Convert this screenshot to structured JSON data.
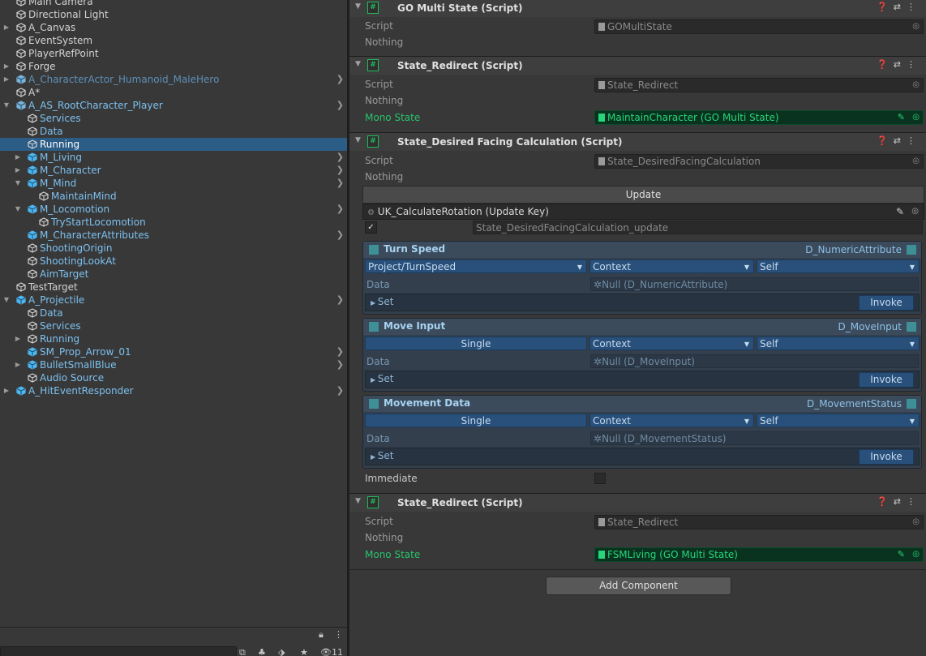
{
  "hierarchy": {
    "items": [
      {
        "label": "Main Camera",
        "indent": 0,
        "fold": "",
        "icon": "cube-icon",
        "chevron": false
      },
      {
        "label": "Directional Light",
        "indent": 0,
        "fold": "",
        "icon": "cube-icon",
        "chevron": false
      },
      {
        "label": "A_Canvas",
        "indent": 0,
        "fold": "▶",
        "icon": "cube-icon",
        "chevron": false
      },
      {
        "label": "EventSystem",
        "indent": 0,
        "fold": "",
        "icon": "cube-icon",
        "chevron": false
      },
      {
        "label": "PlayerRefPoint",
        "indent": 0,
        "fold": "",
        "icon": "cube-icon",
        "chevron": false
      },
      {
        "label": "Forge",
        "indent": 0,
        "fold": "▶",
        "icon": "cube-icon",
        "chevron": false
      },
      {
        "label": "A_CharacterActor_Humanoid_MaleHero",
        "indent": 0,
        "fold": "▶",
        "icon": "prefab-variant-icon",
        "chevron": true,
        "dim": true
      },
      {
        "label": "A*",
        "indent": 0,
        "fold": "",
        "icon": "cube-icon",
        "chevron": false
      },
      {
        "label": "A_AS_RootCharacter_Player",
        "indent": 0,
        "fold": "▼",
        "icon": "prefab-variant-icon",
        "chevron": true,
        "blue": true
      },
      {
        "label": "Services",
        "indent": 1,
        "fold": "",
        "icon": "cube-icon",
        "chevron": false,
        "blue": true
      },
      {
        "label": "Data",
        "indent": 1,
        "fold": "",
        "icon": "cube-icon",
        "chevron": false,
        "blue": true
      },
      {
        "label": "Running",
        "indent": 1,
        "fold": "",
        "icon": "cube-icon",
        "chevron": false,
        "selected": true
      },
      {
        "label": "M_Living",
        "indent": 1,
        "fold": "▶",
        "icon": "prefab-icon",
        "chevron": true,
        "blue": true
      },
      {
        "label": "M_Character",
        "indent": 1,
        "fold": "▶",
        "icon": "prefab-icon",
        "chevron": true,
        "blue": true
      },
      {
        "label": "M_Mind",
        "indent": 1,
        "fold": "▼",
        "icon": "prefab-icon",
        "chevron": true,
        "blue": true
      },
      {
        "label": "MaintainMind",
        "indent": 2,
        "fold": "",
        "icon": "cube-icon",
        "chevron": false,
        "blue": true
      },
      {
        "label": "M_Locomotion",
        "indent": 1,
        "fold": "▼",
        "icon": "prefab-icon",
        "chevron": true,
        "blue": true
      },
      {
        "label": "TryStartLocomotion",
        "indent": 2,
        "fold": "",
        "icon": "cube-icon",
        "chevron": false,
        "blue": true
      },
      {
        "label": "M_CharacterAttributes",
        "indent": 1,
        "fold": "",
        "icon": "prefab-icon",
        "chevron": true,
        "blue": true
      },
      {
        "label": "ShootingOrigin",
        "indent": 1,
        "fold": "",
        "icon": "cube-icon",
        "chevron": false,
        "blue": true
      },
      {
        "label": "ShootingLookAt",
        "indent": 1,
        "fold": "",
        "icon": "cube-icon",
        "chevron": false,
        "blue": true
      },
      {
        "label": "AimTarget",
        "indent": 1,
        "fold": "",
        "icon": "cube-icon",
        "chevron": false,
        "blue": true
      },
      {
        "label": "TestTarget",
        "indent": 0,
        "fold": "",
        "icon": "cube-icon",
        "chevron": false
      },
      {
        "label": "A_Projectile",
        "indent": 0,
        "fold": "▼",
        "icon": "prefab-icon",
        "chevron": true,
        "blue": true
      },
      {
        "label": "Data",
        "indent": 1,
        "fold": "",
        "icon": "cube-icon",
        "chevron": false,
        "blue": true
      },
      {
        "label": "Services",
        "indent": 1,
        "fold": "",
        "icon": "cube-icon",
        "chevron": false,
        "blue": true
      },
      {
        "label": "Running",
        "indent": 1,
        "fold": "▶",
        "icon": "cube-icon",
        "chevron": false,
        "blue": true
      },
      {
        "label": "SM_Prop_Arrow_01",
        "indent": 1,
        "fold": "",
        "icon": "prefab-icon",
        "chevron": true,
        "blue": true
      },
      {
        "label": "BulletSmallBlue",
        "indent": 1,
        "fold": "▶",
        "icon": "prefab-icon",
        "chevron": true,
        "blue": true
      },
      {
        "label": "Audio Source",
        "indent": 1,
        "fold": "",
        "icon": "cube-icon",
        "chevron": false,
        "blue": true
      },
      {
        "label": "A_HitEventResponder",
        "indent": 0,
        "fold": "▶",
        "icon": "prefab-icon",
        "chevron": true,
        "blue": true
      }
    ],
    "hidden_count": "11"
  },
  "inspector": {
    "comp1": {
      "title": "GO Multi State (Script)",
      "script_label": "Script",
      "script_value": "GOMultiState",
      "nothing": "Nothing"
    },
    "comp2": {
      "title": "State_Redirect (Script)",
      "script_label": "Script",
      "script_value": "State_Redirect",
      "nothing": "Nothing",
      "mono_label": "Mono State",
      "mono_value": "MaintainCharacter (GO Multi State)"
    },
    "comp3": {
      "title": "State_Desired Facing Calculation (Script)",
      "script_label": "Script",
      "script_value": "State_DesiredFacingCalculation",
      "nothing": "Nothing",
      "update_header": "Update",
      "update_key": "UK_CalculateRotation (Update Key)",
      "update_name": "State_DesiredFacingCalculation_update",
      "sections": [
        {
          "title": "Turn Speed",
          "type": "D_NumericAttribute",
          "sel1": "Project/TurnSpeed",
          "sel1_dropdown": true,
          "sel2": "Context",
          "sel3": "Self",
          "data_label": "Data",
          "data_value": "Null (D_NumericAttribute)",
          "set_label": "Set",
          "invoke_label": "Invoke"
        },
        {
          "title": "Move Input",
          "type": "D_MoveInput",
          "sel1": "Single",
          "sel1_dropdown": false,
          "sel2": "Context",
          "sel3": "Self",
          "data_label": "Data",
          "data_value": "Null (D_MoveInput)",
          "set_label": "Set",
          "invoke_label": "Invoke"
        },
        {
          "title": "Movement Data",
          "type": "D_MovementStatus",
          "sel1": "Single",
          "sel1_dropdown": false,
          "sel2": "Context",
          "sel3": "Self",
          "data_label": "Data",
          "data_value": "Null (D_MovementStatus)",
          "set_label": "Set",
          "invoke_label": "Invoke"
        }
      ],
      "immediate_label": "Immediate"
    },
    "comp4": {
      "title": "State_Redirect (Script)",
      "script_label": "Script",
      "script_value": "State_Redirect",
      "nothing": "Nothing",
      "mono_label": "Mono State",
      "mono_value": "FSMLiving (GO Multi State)"
    },
    "add_component": "Add Component"
  }
}
